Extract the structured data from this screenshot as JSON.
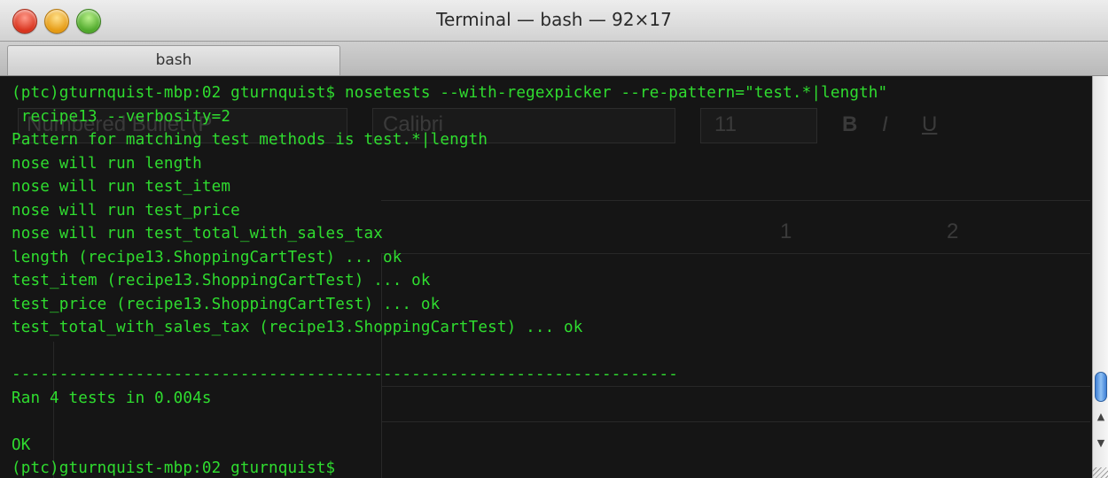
{
  "window": {
    "title": "Terminal — bash — 92×17"
  },
  "tabs": [
    {
      "label": "bash",
      "active": true
    }
  ],
  "terminal": {
    "lines": [
      "(ptc)gturnquist-mbp:02 gturnquist$ nosetests --with-regexpicker --re-pattern=\"test.*|length\"",
      " recipe13 --verbosity=2",
      "Pattern for matching test methods is test.*|length",
      "nose will run length",
      "nose will run test_item",
      "nose will run test_price",
      "nose will run test_total_with_sales_tax",
      "length (recipe13.ShoppingCartTest) ... ok",
      "test_item (recipe13.ShoppingCartTest) ... ok",
      "test_price (recipe13.ShoppingCartTest) ... ok",
      "test_total_with_sales_tax (recipe13.ShoppingCartTest) ... ok",
      "",
      "----------------------------------------------------------------------",
      "Ran 4 tests in 0.004s",
      "",
      "OK",
      "(ptc)gturnquist-mbp:02 gturnquist$"
    ]
  },
  "background_window": {
    "style_label": "Numbered Bullet (P",
    "font_name": "Calibri",
    "font_size": "11",
    "format_buttons": [
      "B",
      "I",
      "U"
    ],
    "ruler_marks": [
      "1",
      "2"
    ]
  },
  "colors": {
    "terminal_bg": "#151515",
    "terminal_fg": "#2fdc2f",
    "scroll_thumb": "#3d7fd6"
  }
}
